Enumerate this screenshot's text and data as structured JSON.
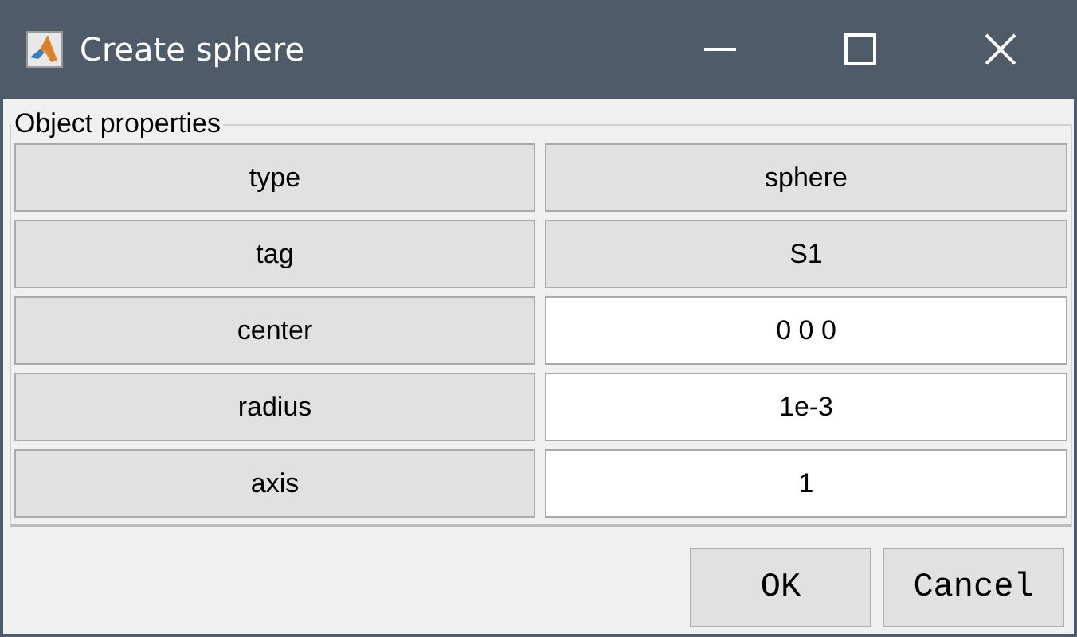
{
  "window": {
    "title": "Create sphere"
  },
  "group": {
    "title": "Object properties"
  },
  "rows": [
    {
      "name": "type",
      "value": "sphere",
      "editable": false
    },
    {
      "name": "tag",
      "value": "S1",
      "editable": false
    },
    {
      "name": "center",
      "value": "0 0 0",
      "editable": true
    },
    {
      "name": "radius",
      "value": "1e-3",
      "editable": true
    },
    {
      "name": "axis",
      "value": "1",
      "editable": true
    }
  ],
  "buttons": [
    "OK",
    "Cancel"
  ]
}
